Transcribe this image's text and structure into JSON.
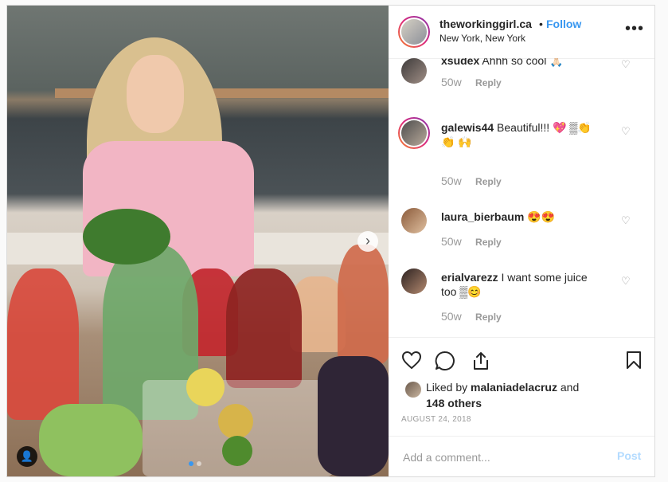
{
  "header": {
    "username": "theworkinggirl.ca",
    "separator": "•",
    "follow_label": "Follow",
    "location": "New York, New York",
    "more_label": "•••"
  },
  "photo": {
    "next_label": "›",
    "user_tag_label": "👤",
    "carousel_count": 2,
    "carousel_active": 1
  },
  "comments": [
    {
      "username": "xsudex",
      "text": "Ahhh so cool 🙏🏻",
      "time": "50w",
      "reply": "Reply"
    },
    {
      "username": "galewis44",
      "text": "Beautiful!!! 💖 ▒👏👏 🙌",
      "time": "50w",
      "reply": "Reply"
    },
    {
      "username": "laura_bierbaum",
      "text": "😍😍",
      "time": "50w",
      "reply": "Reply"
    },
    {
      "username": "erialvarezz",
      "text": "I want some juice too ▒😊",
      "time": "50w",
      "reply": "Reply"
    }
  ],
  "actions": {
    "like_icon": "heart-icon",
    "comment_icon": "comment-icon",
    "share_icon": "share-icon",
    "save_icon": "bookmark-icon"
  },
  "likes": {
    "prefix": "Liked by ",
    "user": "malaniadelacruz",
    "middle": " and",
    "others": "148 others"
  },
  "date": "AUGUST 24, 2018",
  "add_comment": {
    "placeholder": "Add a comment...",
    "post_label": "Post"
  },
  "colors": {
    "accent": "#3897f0",
    "post_disabled": "#b3dbff",
    "muted": "#999999"
  }
}
